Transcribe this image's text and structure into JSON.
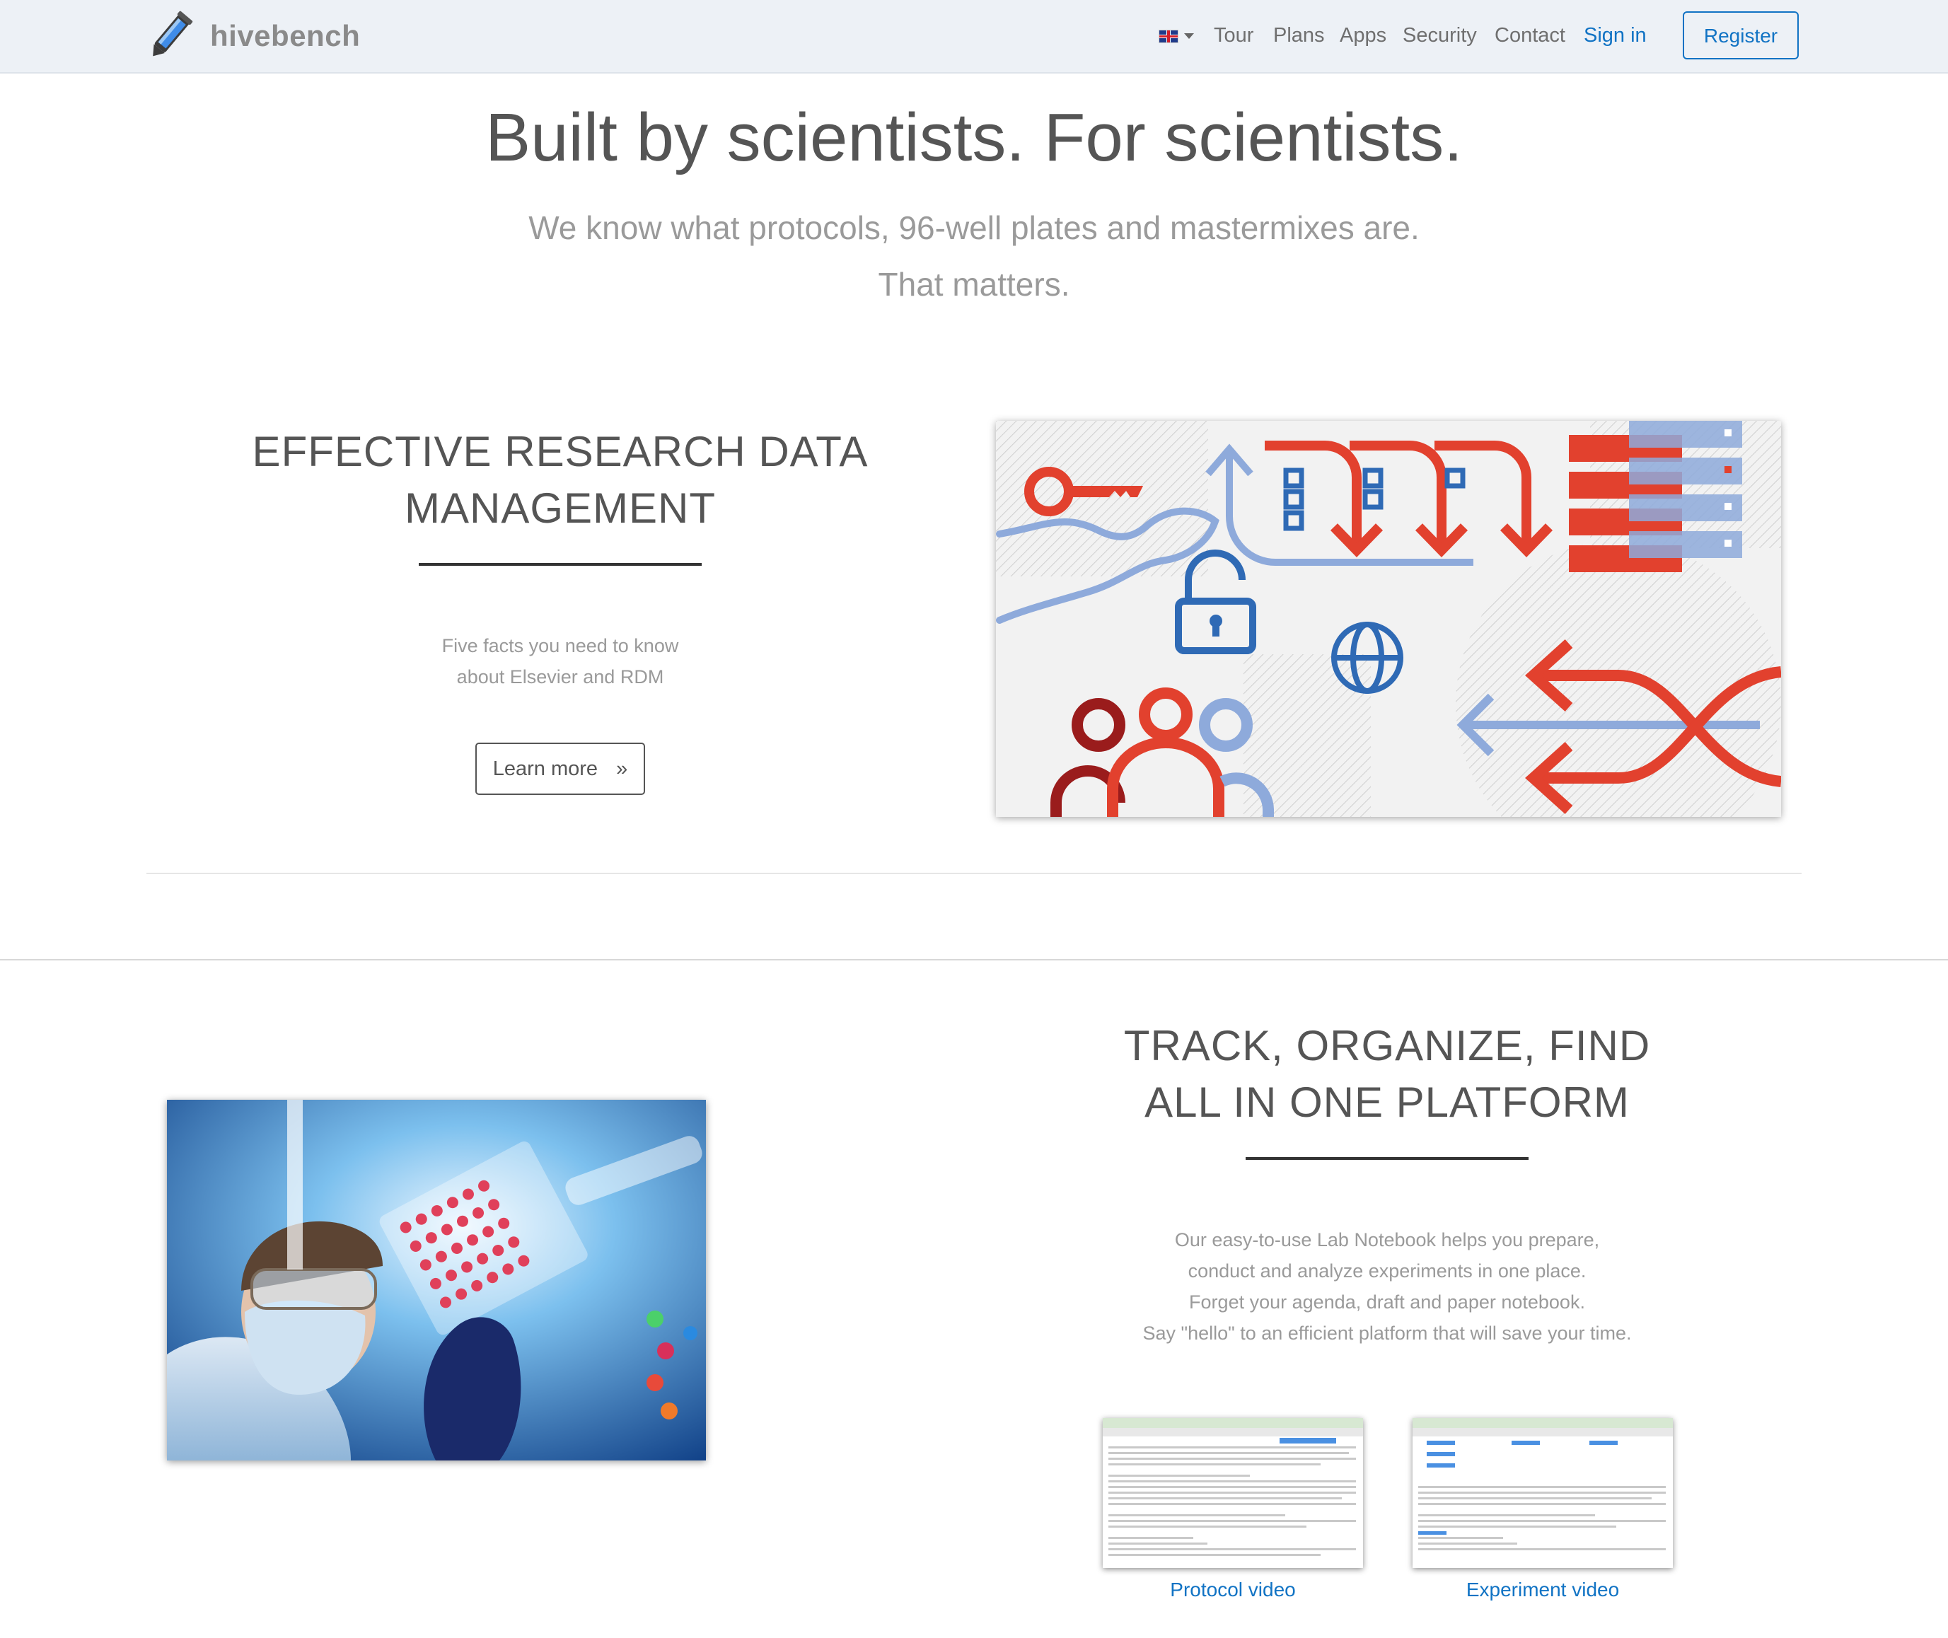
{
  "brand": {
    "name": "hivebench"
  },
  "nav": {
    "language_icon": "uk-flag-icon",
    "items": [
      "Tour",
      "Plans",
      "Apps",
      "Security",
      "Contact"
    ],
    "sign_in": "Sign in",
    "register": "Register"
  },
  "hero": {
    "title": "Built by scientists. For scientists.",
    "subtitle_line1": "We know what protocols, 96-well plates and mastermixes are.",
    "subtitle_line2": "That matters."
  },
  "rdm": {
    "heading_line1": "EFFECTIVE RESEARCH DATA",
    "heading_line2": "MANAGEMENT",
    "text_line1": "Five facts you need to know",
    "text_line2": "about Elsevier and RDM",
    "button_label": "Learn more",
    "button_arrow": "»"
  },
  "platform": {
    "heading_line1": "TRACK, ORGANIZE, FIND",
    "heading_line2": "ALL IN ONE PLATFORM",
    "text_lines": [
      "Our easy-to-use Lab Notebook helps you prepare,",
      "conduct and analyze experiments in one place.",
      "Forget your agenda, draft and paper notebook.",
      "Say \"hello\" to an efficient platform that will save your time."
    ],
    "videos": [
      {
        "label": "Protocol video"
      },
      {
        "label": "Experiment video"
      }
    ]
  },
  "colors": {
    "accent_blue": "#1173c4",
    "illustration_red": "#e2412e",
    "illustration_blue": "#8eaadb",
    "navbar_bg": "#edf1f6"
  }
}
